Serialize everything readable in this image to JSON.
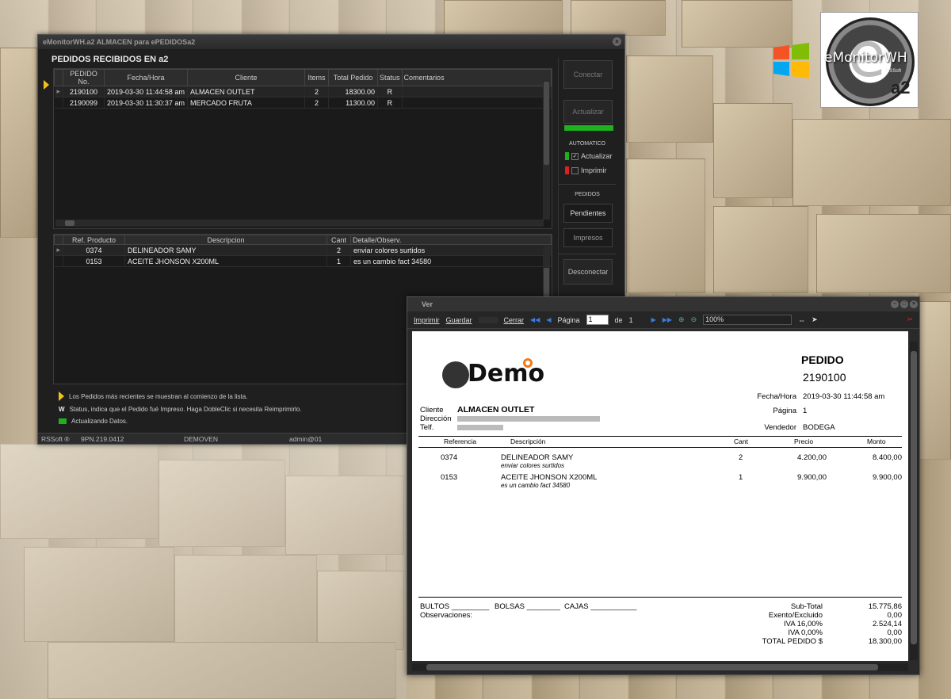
{
  "main_window": {
    "title": "eMonitorWH.a2 ALMACEN para ePEDIDOSa2",
    "heading": "PEDIDOS RECIBIDOS EN a2",
    "orders": {
      "columns": [
        "PEDIDO No.",
        "Fecha/Hora",
        "Cliente",
        "Items",
        "Total Pedido",
        "Status",
        "Comentarios"
      ],
      "rows": [
        {
          "pedido": "2190100",
          "fecha": "2019-03-30 11:44:58 am",
          "cliente": "ALMACEN OUTLET",
          "items": "2",
          "total": "18300.00",
          "status": "R",
          "comentarios": ""
        },
        {
          "pedido": "2190099",
          "fecha": "2019-03-30 11:30:37 am",
          "cliente": "MERCADO FRUTA",
          "items": "2",
          "total": "11300.00",
          "status": "R",
          "comentarios": ""
        }
      ]
    },
    "details": {
      "columns": [
        "Ref. Producto",
        "Descripcion",
        "Cant",
        "Detalle/Observ."
      ],
      "rows": [
        {
          "ref": "0374",
          "desc": "DELINEADOR SAMY",
          "cant": "2",
          "detalle": "enviar colores surtidos"
        },
        {
          "ref": "0153",
          "desc": "ACEITE JHONSON X200ML",
          "cant": "1",
          "detalle": "es  un cambio fact 34580"
        }
      ]
    },
    "side": {
      "conectar": "Conectar",
      "actualizar": "Actualizar",
      "automatico": "AUTOMATICO",
      "chk_actualizar": "Actualizar",
      "chk_imprimir": "Imprimir",
      "pedidos": "PEDIDOS",
      "pendientes": "Pendientes",
      "impresos": "Impresos",
      "desconectar": "Desconectar"
    },
    "legend": {
      "line1": "Los Pedidos más recientes se muestran al comienzo de la lista.",
      "w_letter": "W",
      "line2": "Status, indica que el Pedido fué Impreso. Haga DobleClic si necesita Reimprimirlo.",
      "line3": "Actualizando Datos."
    },
    "status": {
      "brand": "RSSoft ®",
      "version": "9PN.219.0412",
      "company": "DEMOVEN",
      "user": "admin@01"
    },
    "colors": {
      "accent_green": "#1eb01e",
      "arrow_yellow": "#f3c21a",
      "led_red": "#e02020"
    }
  },
  "logo": {
    "brand": "eMonitorWH",
    "sub": "RSSoft",
    "suffix": "a2"
  },
  "ver_window": {
    "title": "Ver",
    "toolbar": {
      "imprimir": "Imprimir",
      "guardar": "Guardar",
      "cerrar": "Cerrar",
      "pagina_label": "Página",
      "pagina_value": "1",
      "de_label": "de",
      "total_pages": "1",
      "zoom": "100%"
    },
    "doc": {
      "logo_text": "Demo",
      "title": "PEDIDO",
      "number": "2190100",
      "fecha_label": "Fecha/Hora",
      "fecha_value": "2019-03-30 11:44:58 am",
      "pagina_label": "Página",
      "pagina_value": "1",
      "vendedor_label": "Vendedor",
      "vendedor_value": "BODEGA",
      "cliente_label": "Cliente",
      "cliente_value": "ALMACEN OUTLET",
      "direccion_label": "Dirección",
      "telf_label": "Telf.",
      "columns": {
        "ref": "Referencia",
        "desc": "Descripción",
        "cant": "Cant",
        "precio": "Precio",
        "monto": "Monto"
      },
      "lines": [
        {
          "ref": "0374",
          "desc": "DELINEADOR SAMY",
          "note": "enviar colores surtidos",
          "cant": "2",
          "precio": "4.200,00",
          "monto": "8.400,00"
        },
        {
          "ref": "0153",
          "desc": "ACEITE JHONSON X200ML",
          "note": "es  un cambio fact 34580",
          "cant": "1",
          "precio": "9.900,00",
          "monto": "9.900,00"
        }
      ],
      "footer_left": {
        "bultos": "BULTOS _________",
        "bolsas": "BOLSAS ________",
        "cajas": "CAJAS ___________",
        "observaciones": "Observaciones:"
      },
      "totals": [
        {
          "label": "Sub-Total",
          "value": "15.775,86"
        },
        {
          "label": "Exento/Excluido",
          "value": "0,00"
        },
        {
          "label": "IVA 16,00%",
          "value": "2.524,14"
        },
        {
          "label": "IVA 0,00%",
          "value": "0,00"
        },
        {
          "label": "TOTAL PEDIDO $",
          "value": "18.300,00"
        }
      ]
    }
  }
}
